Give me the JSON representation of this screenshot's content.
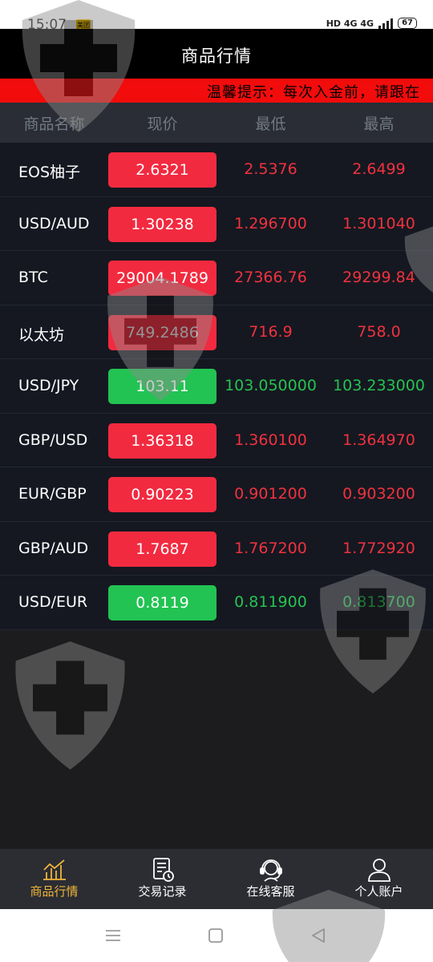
{
  "status_bar": {
    "time": "15:07",
    "app_badge": "美团",
    "network": "HD 4G 4G",
    "battery": "67"
  },
  "header": {
    "title": "商品行情"
  },
  "notice": {
    "text": "温馨提示：每次入金前，请跟在"
  },
  "table": {
    "headers": [
      "商品名称",
      "现价",
      "最低",
      "最高"
    ],
    "rows": [
      {
        "name": "EOS柚子",
        "price": "2.6321",
        "low": "2.5376",
        "high": "2.6499",
        "trend": "up"
      },
      {
        "name": "USD/AUD",
        "price": "1.30238",
        "low": "1.296700",
        "high": "1.301040",
        "trend": "up"
      },
      {
        "name": "BTC",
        "price": "29004.1789",
        "low": "27366.76",
        "high": "29299.84",
        "trend": "up"
      },
      {
        "name": "以太坊",
        "price": "749.2486",
        "low": "716.9",
        "high": "758.0",
        "trend": "up"
      },
      {
        "name": "USD/JPY",
        "price": "103.11",
        "low": "103.050000",
        "high": "103.233000",
        "trend": "down"
      },
      {
        "name": "GBP/USD",
        "price": "1.36318",
        "low": "1.360100",
        "high": "1.364970",
        "trend": "up"
      },
      {
        "name": "EUR/GBP",
        "price": "0.90223",
        "low": "0.901200",
        "high": "0.903200",
        "trend": "up"
      },
      {
        "name": "GBP/AUD",
        "price": "1.7687",
        "low": "1.767200",
        "high": "1.772920",
        "trend": "up"
      },
      {
        "name": "USD/EUR",
        "price": "0.8119",
        "low": "0.811900",
        "high": "0.813700",
        "trend": "down"
      }
    ]
  },
  "bottom_nav": {
    "items": [
      {
        "label": "商品行情",
        "icon": "chart-icon",
        "active": true
      },
      {
        "label": "交易记录",
        "icon": "document-clock-icon",
        "active": false
      },
      {
        "label": "在线客服",
        "icon": "headset-icon",
        "active": false
      },
      {
        "label": "个人账户",
        "icon": "user-icon",
        "active": false
      }
    ]
  },
  "colors": {
    "up": "#f22a3f",
    "down": "#22c352",
    "active_tab": "#f0b43a",
    "notice_bg": "#f20c0c"
  }
}
